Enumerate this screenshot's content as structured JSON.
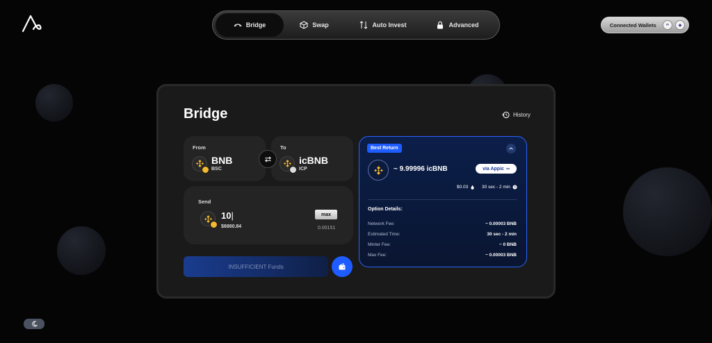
{
  "nav": {
    "tabs": [
      {
        "label": "Bridge",
        "icon": "bridge-icon",
        "active": true
      },
      {
        "label": "Swap",
        "icon": "cube-icon"
      },
      {
        "label": "Auto Invest",
        "icon": "arrows-icon"
      },
      {
        "label": "Advanced",
        "icon": "lock-icon"
      }
    ]
  },
  "wallets": {
    "label": "Connected Wallets"
  },
  "card": {
    "title": "Bridge",
    "history_label": "History",
    "from": {
      "caption": "From",
      "token": "BNB",
      "chain": "BSC"
    },
    "to": {
      "caption": "To",
      "token": "icBNB",
      "chain": "ICP"
    },
    "send": {
      "caption": "Send",
      "amount": "10",
      "usd": "$6880.84",
      "max_label": "max",
      "balance": "0.00151"
    },
    "submit_label": "INSUFFICIENT Funds"
  },
  "best_return": {
    "badge": "Best Return",
    "amount": "~ 9.99996 icBNB",
    "via_label": "via Appic",
    "fee_short": "$0.03",
    "time_short": "30 sec - 2 min",
    "details_title": "Option Details:",
    "details": [
      {
        "label": "Network Fee:",
        "value": "~ 0.00003 BNB"
      },
      {
        "label": "Estimated Time:",
        "value": "30 sec - 2 min"
      },
      {
        "label": "Minter Fee:",
        "value": "~ 0 BNB"
      },
      {
        "label": "Max Fee:",
        "value": "~ 0.00003 BNB"
      }
    ]
  },
  "colors": {
    "accent": "#1f5cff",
    "bnb": "#f3ba2f",
    "panel": "#0c1f4a"
  }
}
